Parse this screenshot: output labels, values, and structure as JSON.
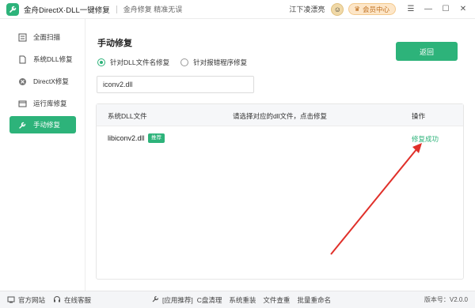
{
  "titlebar": {
    "app_title": "金舟DirectX·DLL一键修复",
    "subtitle": "金舟修复 精准无误",
    "username": "江下凌漂亮",
    "vip_label": "会员中心"
  },
  "sidebar": {
    "items": [
      {
        "label": "全面扫描",
        "icon": "scan-icon"
      },
      {
        "label": "系统DLL修复",
        "icon": "file-icon"
      },
      {
        "label": "DirectX修复",
        "icon": "directx-icon"
      },
      {
        "label": "运行库修复",
        "icon": "library-icon"
      },
      {
        "label": "手动修复",
        "icon": "wrench-icon",
        "active": true
      }
    ]
  },
  "main": {
    "title": "手动修复",
    "radio_dll": "针对DLL文件名修复",
    "radio_exe": "针对报错程序修复",
    "search_value": "iconv2.dll",
    "back_button": "返回",
    "table": {
      "headers": [
        "系统DLL文件",
        "请选择对应的dll文件，点击修复",
        "操作"
      ],
      "rows": [
        {
          "file": "libiconv2.dll",
          "tag": "推荐",
          "status": "修复成功"
        }
      ]
    }
  },
  "footer": {
    "website": "官方网站",
    "support": "在线客服",
    "recommend": "[应用推荐]",
    "links": [
      "C盘清理",
      "系统重装",
      "文件查重",
      "批量重命名"
    ],
    "version": "版本号：V2.0.0"
  },
  "colors": {
    "accent": "#2db37a",
    "annotation_arrow": "#e0302a"
  }
}
